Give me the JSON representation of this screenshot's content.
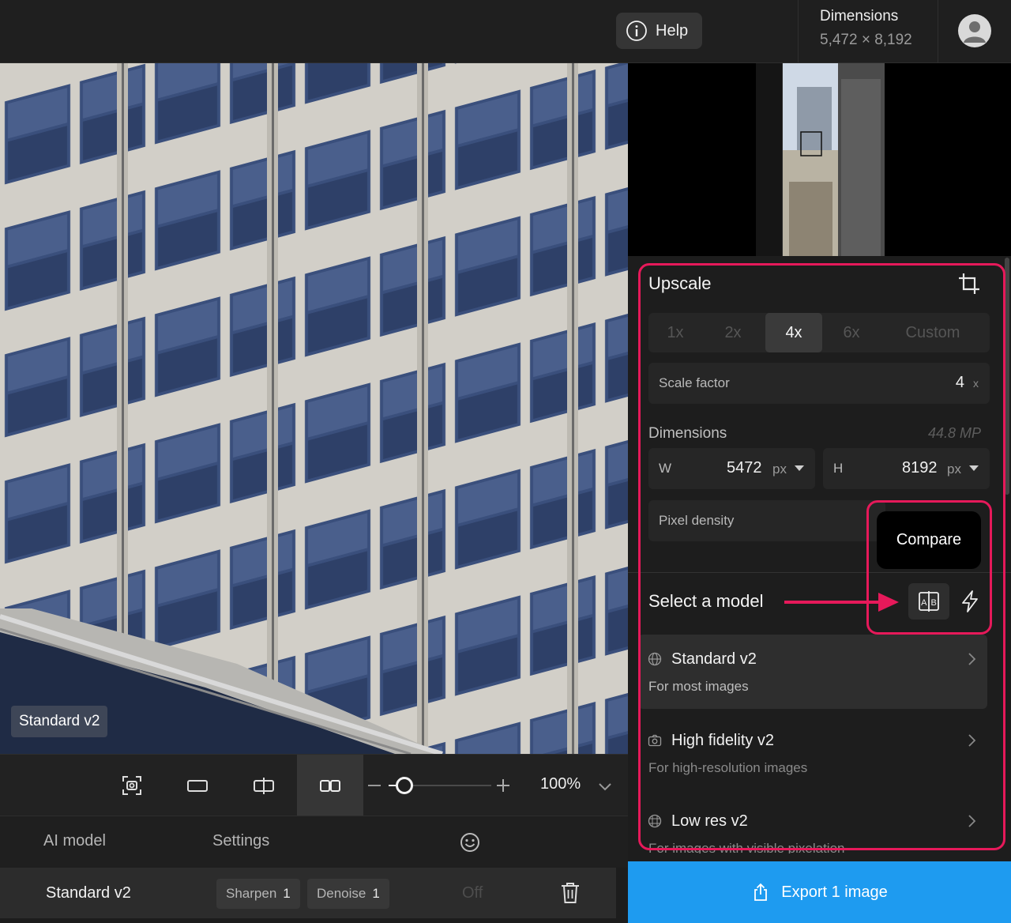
{
  "topbar": {
    "help_label": "Help",
    "dimensions_title": "Dimensions",
    "dimensions_value": "5,472 × 8,192"
  },
  "canvas": {
    "model_label": "Standard v2"
  },
  "viewbar": {
    "zoom_level": "100%",
    "zoom_fraction": 0.15,
    "active_view": "side-by-side"
  },
  "bottom": {
    "tabs": [
      "AI model",
      "Settings"
    ],
    "model_row": {
      "name": "Standard v2",
      "chips": [
        {
          "label": "Sharpen",
          "value": "1"
        },
        {
          "label": "Denoise",
          "value": "1"
        }
      ],
      "toggle": "Off"
    }
  },
  "panel": {
    "title": "Upscale",
    "scale_options": [
      "1x",
      "2x",
      "4x",
      "6x",
      "Custom"
    ],
    "scale_selected": "4x",
    "scale_factor_label": "Scale factor",
    "scale_factor_value": "4",
    "scale_factor_unit": "x",
    "dimensions_label": "Dimensions",
    "megapixels": "44.8 MP",
    "width_label": "W",
    "width_value": "5472",
    "width_unit": "px",
    "height_label": "H",
    "height_value": "8192",
    "height_unit": "px",
    "pixel_density_label": "Pixel density",
    "compare_tooltip": "Compare",
    "select_model_label": "Select a model",
    "models": [
      {
        "name": "Standard v2",
        "desc": "For most images",
        "icon": "globe-icon"
      },
      {
        "name": "High fidelity v2",
        "desc": "For high-resolution images",
        "icon": "camera-icon"
      },
      {
        "name": "Low res v2",
        "desc": "For images with visible pixelation",
        "icon": "pixel-globe-icon"
      }
    ],
    "export_label": "Export 1 image"
  },
  "colors": {
    "highlight": "#e6195a",
    "export_blue": "#1e9bf0"
  }
}
